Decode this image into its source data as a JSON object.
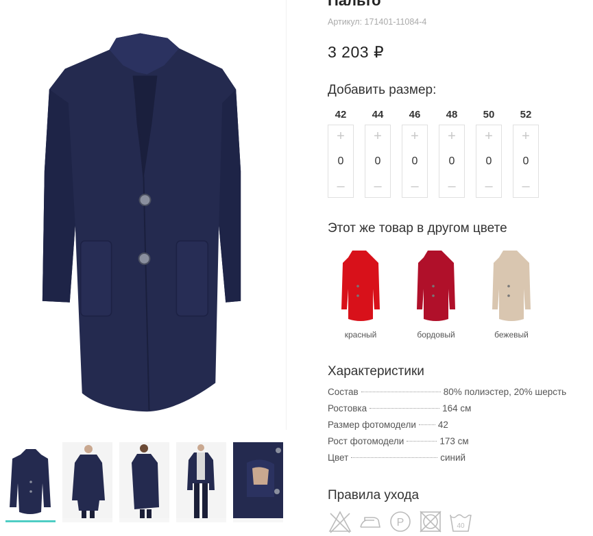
{
  "product": {
    "title": "Пальто",
    "article": "Артикул: 171401-11084-4",
    "price": "3 203 ₽"
  },
  "sizes_section": {
    "heading": "Добавить размер:",
    "plus": "+",
    "minus": "–",
    "sizes": [
      {
        "label": "42",
        "qty": "0"
      },
      {
        "label": "44",
        "qty": "0"
      },
      {
        "label": "46",
        "qty": "0"
      },
      {
        "label": "48",
        "qty": "0"
      },
      {
        "label": "50",
        "qty": "0"
      },
      {
        "label": "52",
        "qty": "0"
      }
    ]
  },
  "colors_section": {
    "heading": "Этот же товар в другом цвете",
    "items": [
      {
        "name": "красный",
        "color": "#d8111a"
      },
      {
        "name": "бордовый",
        "color": "#b0102a"
      },
      {
        "name": "бежевый",
        "color": "#d9c6b0"
      }
    ]
  },
  "characteristics": {
    "heading": "Характеристики",
    "rows": [
      {
        "key": "Состав",
        "value": "80% полиэстер, 20% шерсть"
      },
      {
        "key": "Ростовка",
        "value": "164 см"
      },
      {
        "key": "Размер фотомодели",
        "value": "42"
      },
      {
        "key": "Рост фотомодели",
        "value": "173 см"
      },
      {
        "key": "Цвет",
        "value": "синий"
      }
    ]
  },
  "care": {
    "heading": "Правила ухода",
    "icons": [
      "no-bleach-icon",
      "iron-icon",
      "dry-clean-p-icon",
      "no-tumble-dry-icon",
      "wash-40-icon"
    ],
    "wash_temp": "40"
  },
  "main_color": "#242a4f",
  "accent": "#4ecdc4"
}
